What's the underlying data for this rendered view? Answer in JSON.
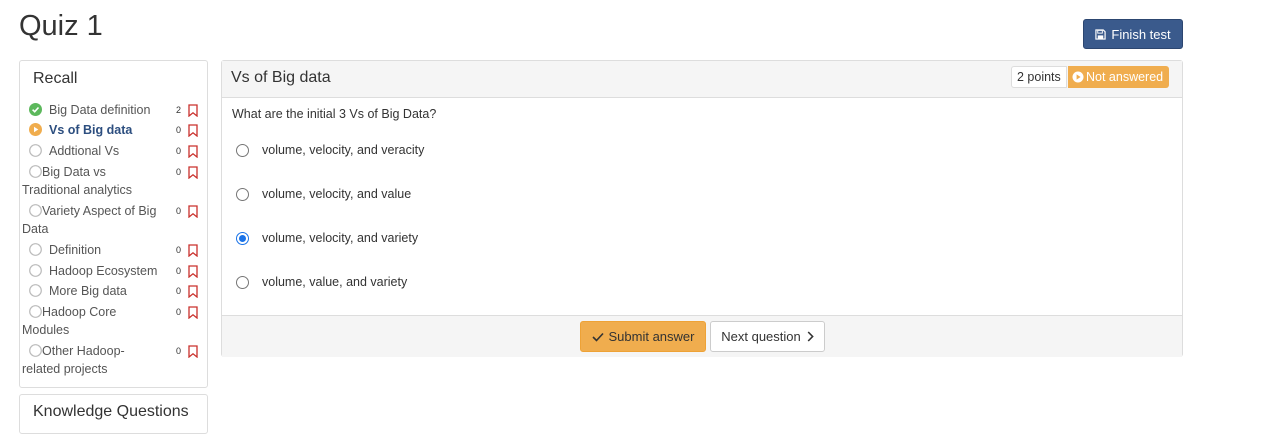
{
  "page": {
    "title": "Quiz 1"
  },
  "toolbar": {
    "finish_label": "Finish test",
    "finish_icon": "floppy-disk-icon"
  },
  "sidebar": {
    "title": "Recall",
    "items": [
      {
        "label": "Big Data definition",
        "count": "2",
        "status": "answered"
      },
      {
        "label": "Vs of Big data",
        "count": "0",
        "status": "current"
      },
      {
        "label": "Addtional Vs",
        "count": "0",
        "status": "unanswered"
      },
      {
        "label": "Big Data vs Traditional analytics",
        "count": "0",
        "status": "unanswered"
      },
      {
        "label": "Variety Aspect of Big Data",
        "count": "0",
        "status": "unanswered"
      },
      {
        "label": "Definition",
        "count": "0",
        "status": "unanswered"
      },
      {
        "label": "Hadoop Ecosystem",
        "count": "0",
        "status": "unanswered"
      },
      {
        "label": "More Big data",
        "count": "0",
        "status": "unanswered"
      },
      {
        "label": "Hadoop Core Modules",
        "count": "0",
        "status": "unanswered"
      },
      {
        "label": "Other Hadoop-related projects",
        "count": "0",
        "status": "unanswered"
      }
    ]
  },
  "sidebar2": {
    "title": "Knowledge Questions"
  },
  "question": {
    "title": "Vs of Big data",
    "points": "2 points",
    "status": "Not answered",
    "text": "What are the initial 3 Vs of Big Data?",
    "options": [
      {
        "label": "volume, velocity, and veracity",
        "selected": false
      },
      {
        "label": "volume, velocity, and value",
        "selected": false
      },
      {
        "label": "volume, velocity, and variety",
        "selected": true
      },
      {
        "label": "volume, value, and variety",
        "selected": false
      }
    ],
    "submit_label": "Submit answer",
    "next_label": "Next question"
  },
  "colors": {
    "primary": "#3a5a8c",
    "warning": "#f0ad4e",
    "success": "#5cb85c",
    "bookmark": "#c9302c",
    "radio_selected": "#1a73e8"
  }
}
